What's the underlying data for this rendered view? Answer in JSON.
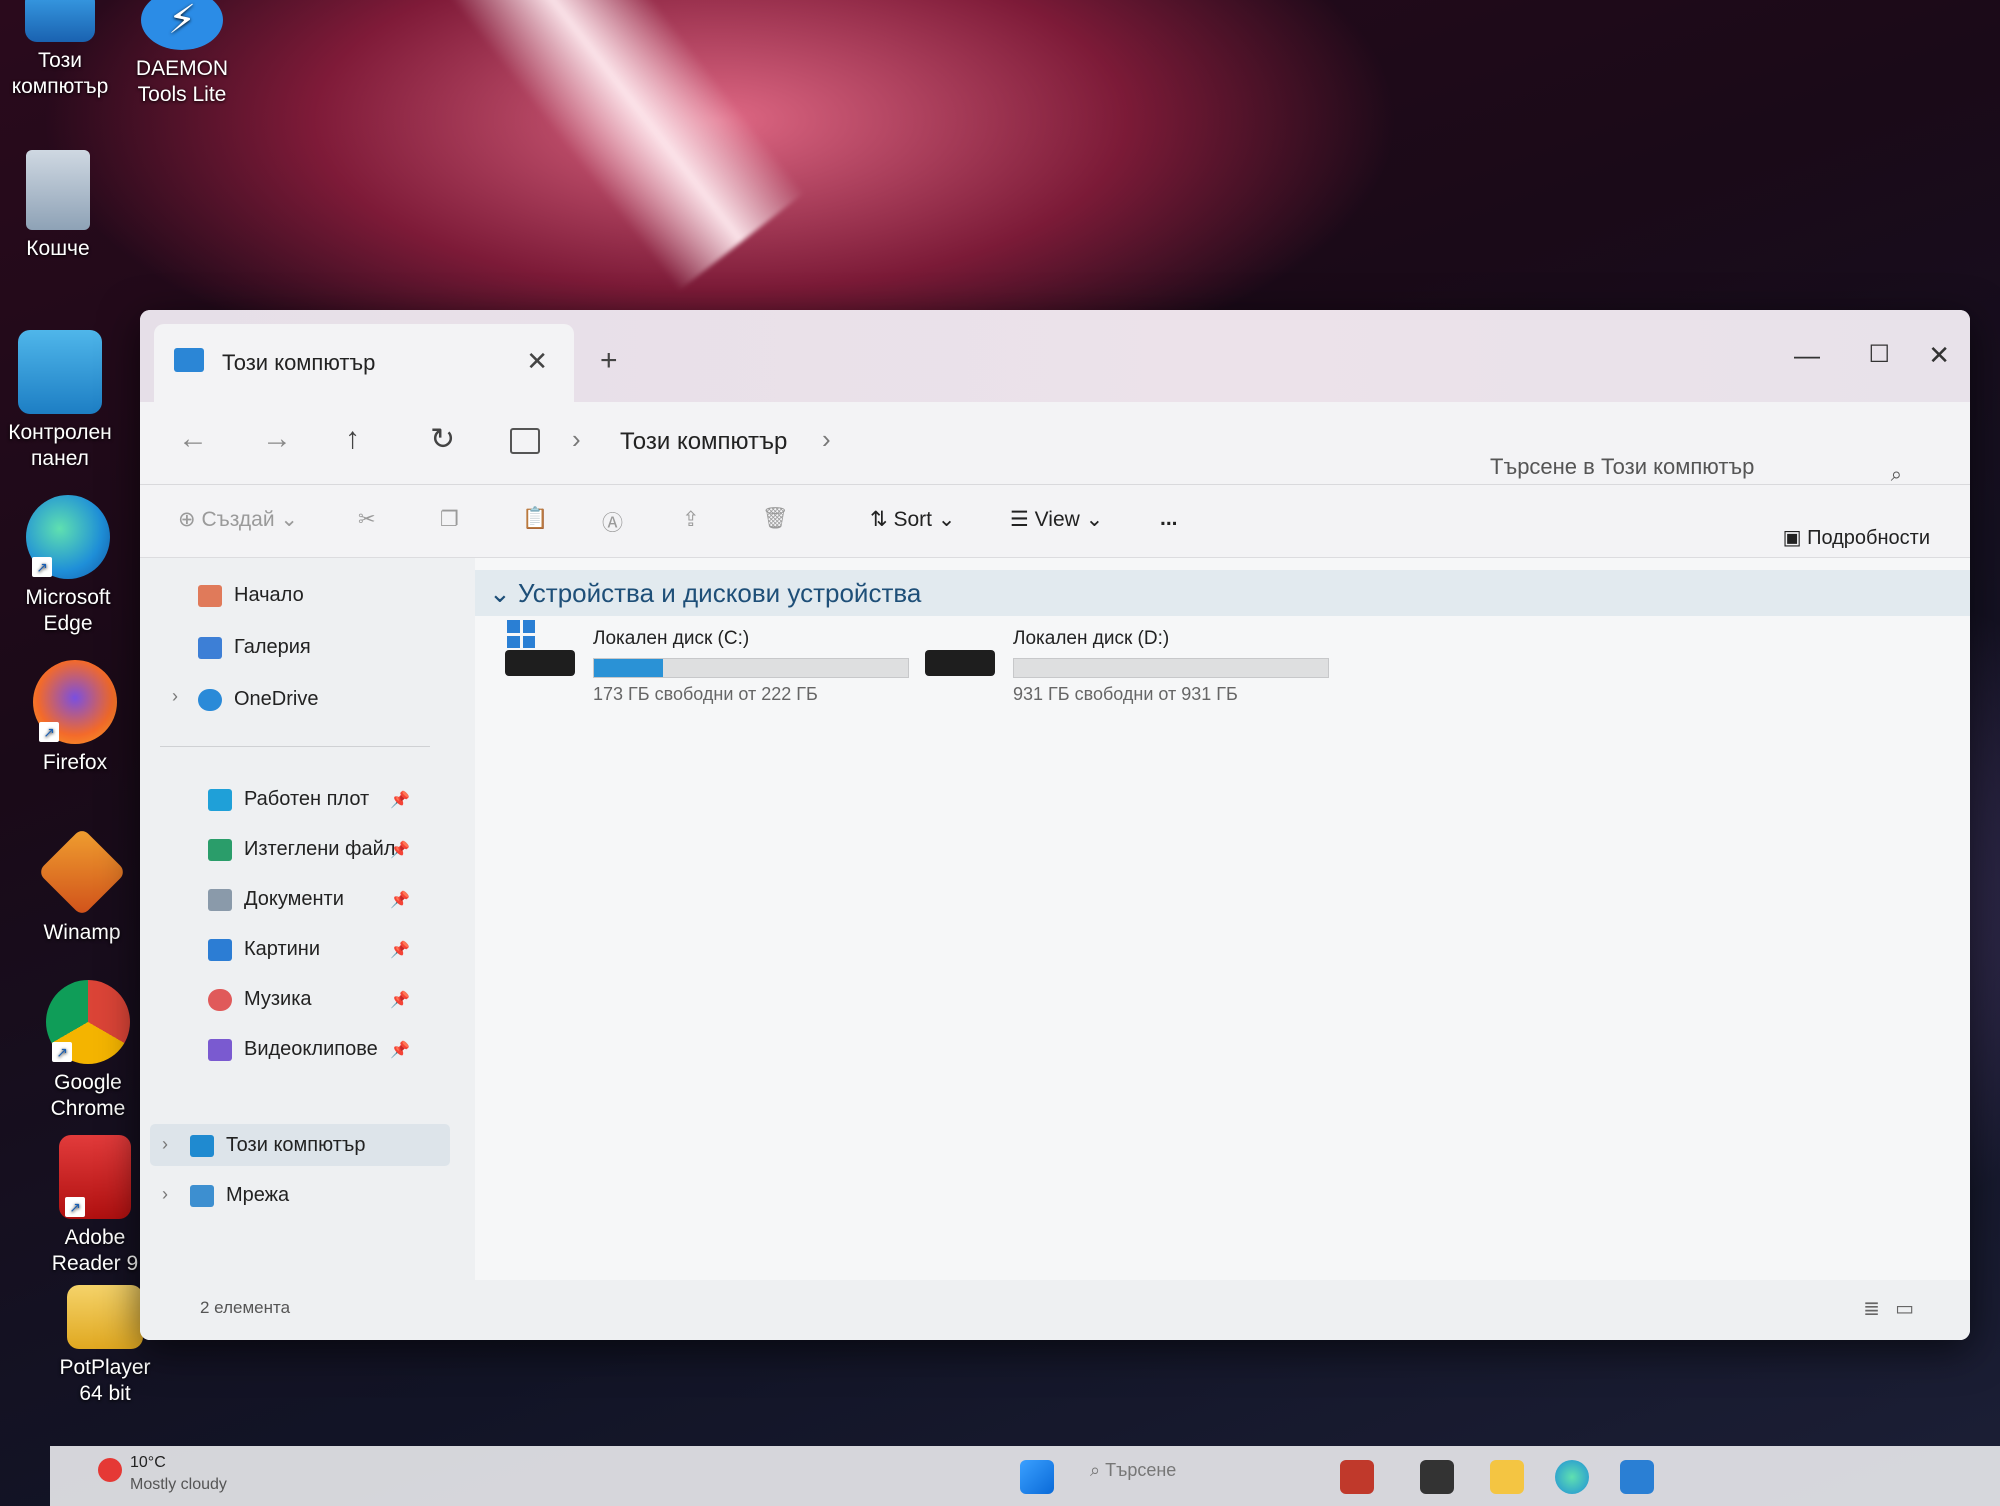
{
  "desktop": {
    "icons": [
      {
        "label": "Този компютър"
      },
      {
        "label": "DAEMON Tools Lite"
      },
      {
        "label": "Кошче"
      },
      {
        "label": "Контролен панел"
      },
      {
        "label": "Microsoft Edge"
      },
      {
        "label": "Firefox"
      },
      {
        "label": "Winamp"
      },
      {
        "label": "Google Chrome"
      },
      {
        "label": "Adobe Reader 9"
      },
      {
        "label": "PotPlayer 64 bit"
      }
    ]
  },
  "window": {
    "tab_title": "Този компютър",
    "new_tab": "+",
    "breadcrumb": "Този компютър",
    "search_placeholder": "Търсене в Този компютър",
    "toolbar": {
      "new_label": "Създай",
      "sort_label": "Sort",
      "view_label": "View",
      "more_label": "...",
      "details_label": "Подробности"
    },
    "sidebar": {
      "home": "Начало",
      "gallery": "Галерия",
      "onedrive": "OneDrive",
      "quick": [
        {
          "label": "Работен плот"
        },
        {
          "label": "Изтеглени файл"
        },
        {
          "label": "Документи"
        },
        {
          "label": "Картини"
        },
        {
          "label": "Музика"
        },
        {
          "label": "Видеоклипове"
        }
      ],
      "this_pc": "Този компютър",
      "network": "Мрежа"
    },
    "group_title": "Устройства и дискови устройства",
    "drives": [
      {
        "name": "Локален диск (C:)",
        "free_text": "173 ГБ свободни от 222 ГБ",
        "used_fraction": 0.22
      },
      {
        "name": "Локален диск (D:)",
        "free_text": "931 ГБ свободни от 931 ГБ",
        "used_fraction": 0.0
      }
    ],
    "status": "2 елемента"
  },
  "taskbar": {
    "weather_temp": "10°C",
    "weather_condition": "Mostly cloudy",
    "search_placeholder": "Търсене"
  },
  "colors": {
    "accent": "#2a92d6",
    "group_header": "#e2eaef"
  }
}
